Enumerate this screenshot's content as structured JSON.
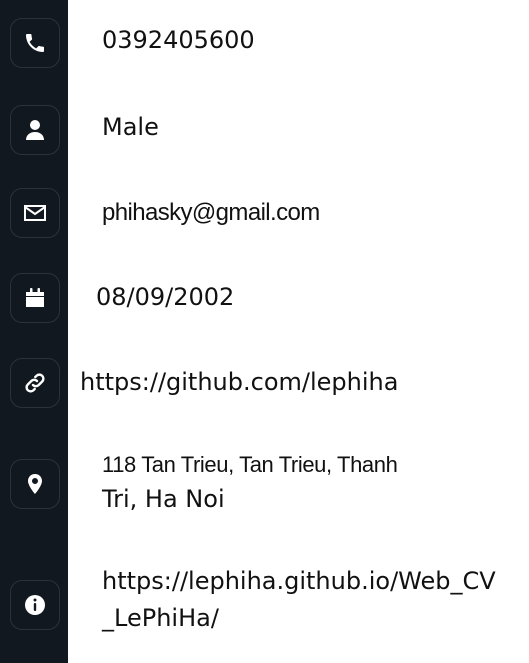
{
  "contact": {
    "phone": "0392405600",
    "gender": "Male",
    "email": "phihasky@gmail.com",
    "birthday": "08/09/2002",
    "github": "https://github.com/lephiha",
    "address_line1": "118 Tan Trieu, Tan Trieu, Thanh",
    "address_line2": "Tri, Ha Noi",
    "website_line1": "https://lephiha.github.io/Web_CV",
    "website_line2": "_LePhiHa/"
  },
  "icons": [
    "phone-icon",
    "user-icon",
    "envelope-icon",
    "calendar-icon",
    "link-icon",
    "location-pin-icon",
    "info-icon"
  ],
  "colors": {
    "rail": "#111820",
    "icon": "#ffffff",
    "text": "#111111",
    "background": "#ffffff"
  }
}
